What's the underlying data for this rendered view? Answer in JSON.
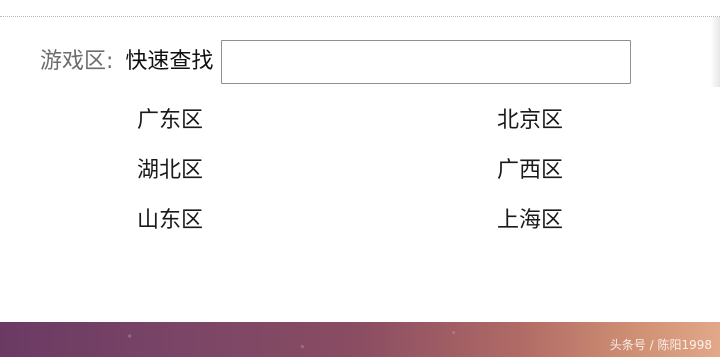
{
  "search": {
    "zone_label": "游戏区:",
    "quick_label": "快速查找",
    "value": "",
    "placeholder": ""
  },
  "regions": [
    "广东区",
    "北京区",
    "湖北区",
    "广西区",
    "山东区",
    "上海区"
  ],
  "watermark": "头条号 / 陈阳1998"
}
